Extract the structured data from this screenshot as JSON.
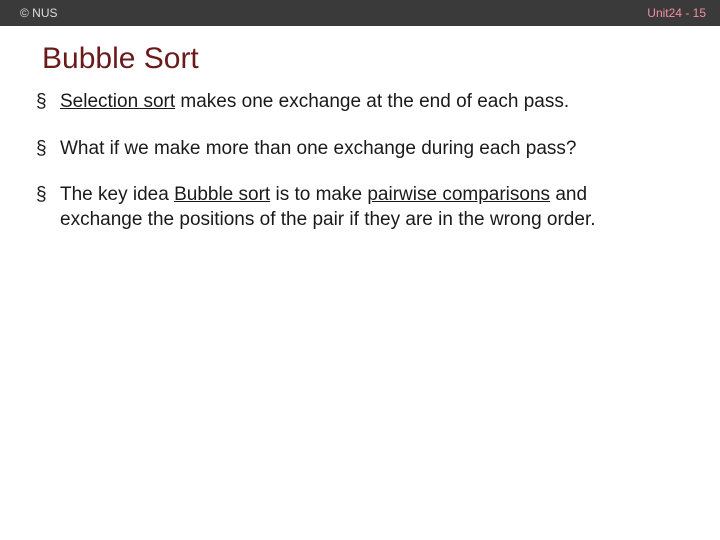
{
  "header": {
    "left": "© NUS",
    "right": "Unit24 - 15"
  },
  "title": "Bubble Sort",
  "bullets": [
    {
      "pre": "",
      "u1": "Selection sort",
      "mid": " makes one exchange at the end of each pass.",
      "u2": "",
      "post": ""
    },
    {
      "pre": "What if we make more than one exchange during each pass?",
      "u1": "",
      "mid": "",
      "u2": "",
      "post": ""
    },
    {
      "pre": "The key idea ",
      "u1": "Bubble sort",
      "mid": " is to make ",
      "u2": "pairwise comparisons",
      "post": " and exchange the positions of the pair if they are in the wrong order."
    }
  ]
}
